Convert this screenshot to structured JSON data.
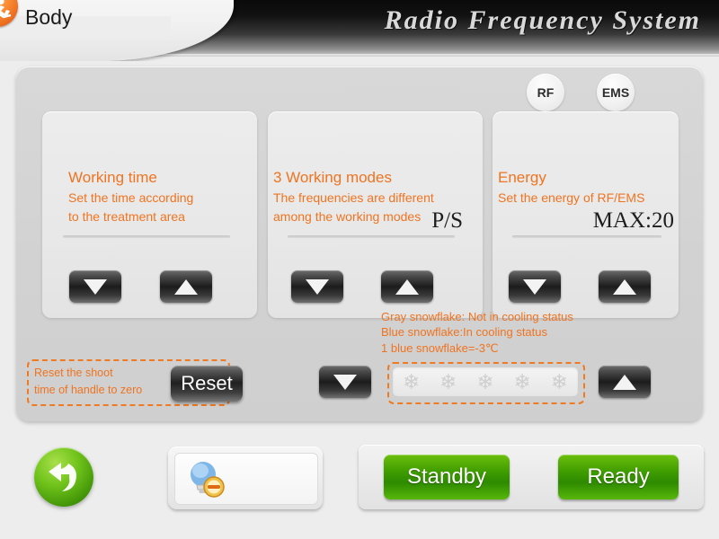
{
  "header": {
    "title": "Radio  Frequency  System",
    "tab_label": "Body",
    "logo_icon": "running-person-icon"
  },
  "mode_buttons": [
    {
      "label": "RF",
      "name": "rf"
    },
    {
      "label": "EMS",
      "name": "ems"
    }
  ],
  "cards": {
    "working_time": {
      "title": "Working time",
      "sub_line1": "Set the time according",
      "sub_line2": "to the treatment area",
      "value": ""
    },
    "working_modes": {
      "title": "3 Working modes",
      "sub_line1": "The frequencies are different",
      "sub_line2": "among the working modes",
      "value": "P/S"
    },
    "energy": {
      "title": "Energy",
      "sub_line1": "Set the energy of RF/EMS",
      "sub_line2": "",
      "value": "MAX:20"
    }
  },
  "reset": {
    "note_line1": "Reset the shoot",
    "note_line2": "time of handle to zero",
    "button_label": "Reset"
  },
  "cooling": {
    "note_line1": "Gray snowflake: Not in cooling status",
    "note_line2": "Blue snowflake:In cooling status",
    "note_line3": "1 blue snowflake=-3℃",
    "snowflakes": [
      "❄",
      "❄",
      "❄",
      "❄",
      "❄"
    ],
    "snowflake_color": "#cfcfcf"
  },
  "bottom": {
    "back_icon": "back-arrow-icon",
    "lamp_icon": "lightbulb-disabled-icon",
    "standby_label": "Standby",
    "ready_label": "Ready"
  },
  "colors": {
    "accent_orange": "#ef7421",
    "green": "#3f9d00",
    "background": "#ededed"
  }
}
